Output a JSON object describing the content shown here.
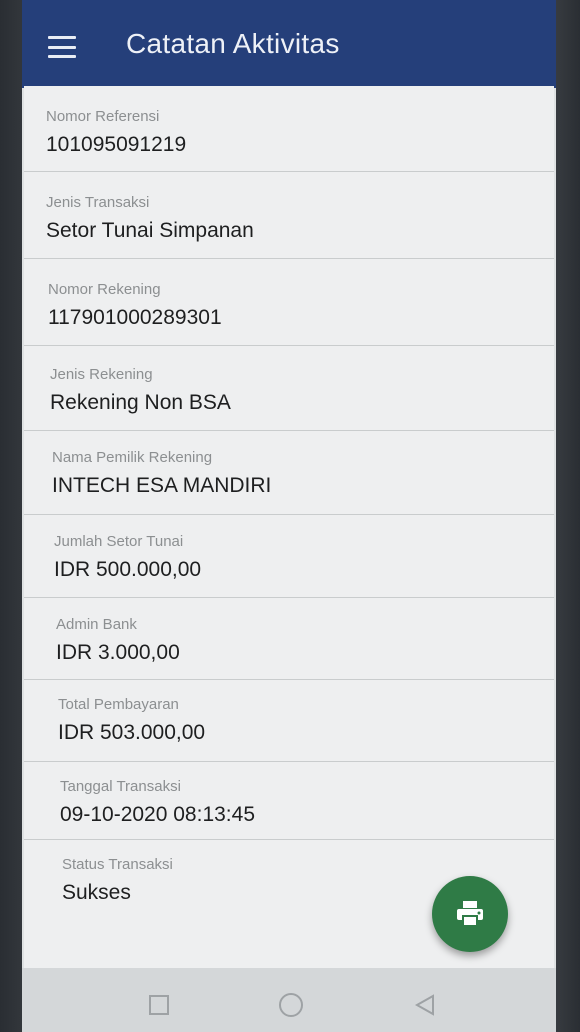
{
  "header": {
    "title": "Catatan Aktivitas",
    "menu_icon": "hamburger-menu-icon"
  },
  "details": [
    {
      "label": "Nomor Referensi",
      "value": "101095091219"
    },
    {
      "label": "Jenis Transaksi",
      "value": "Setor Tunai Simpanan"
    },
    {
      "label": "Nomor Rekening",
      "value": "117901000289301"
    },
    {
      "label": "Jenis Rekening",
      "value": "Rekening Non BSA"
    },
    {
      "label": "Nama Pemilik Rekening",
      "value": "INTECH ESA MANDIRI"
    },
    {
      "label": "Jumlah Setor Tunai",
      "value": "IDR 500.000,00"
    },
    {
      "label": "Admin Bank",
      "value": "IDR 3.000,00"
    },
    {
      "label": "Total Pembayaran",
      "value": "IDR 503.000,00"
    },
    {
      "label": "Tanggal Transaksi",
      "value": "09-10-2020 08:13:45"
    },
    {
      "label": "Status Transaksi",
      "value": "Sukses"
    }
  ],
  "fab": {
    "icon": "printer-icon",
    "color": "#2f7b46"
  },
  "nav": {
    "recents_icon": "square-recents-icon",
    "home_icon": "circle-home-icon",
    "back_icon": "triangle-back-icon"
  },
  "colors": {
    "app_bar": "#253f7a",
    "card": "#eeeff0",
    "label": "#8c8f91",
    "value": "#1e1f20"
  }
}
